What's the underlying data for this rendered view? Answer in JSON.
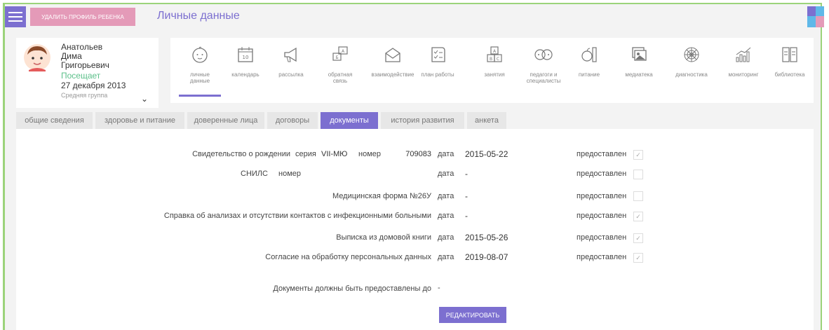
{
  "header": {
    "delete_label": "УДАЛИТЬ ПРОФИЛЬ РЕБЕНКА",
    "page_title": "Личные данные"
  },
  "profile": {
    "name_line1": "Анатольев",
    "name_line2": "Дима",
    "name_line3": "Григорьевич",
    "status": "Посещает",
    "birth_date": "27 декабря 2013",
    "group": "Средняя группа"
  },
  "nav": {
    "items": [
      {
        "label": "личные данные",
        "icon": "baby-face-icon"
      },
      {
        "label": "календарь",
        "icon": "calendar-icon"
      },
      {
        "label": "рассылка",
        "icon": "megaphone-icon"
      },
      {
        "label": "обратная связь",
        "icon": "feedback-icon"
      },
      {
        "label": "взаимодействие",
        "icon": "envelope-icon"
      },
      {
        "label": "план работы",
        "icon": "checklist-icon"
      },
      {
        "label": "занятия",
        "icon": "blocks-icon"
      },
      {
        "label": "педагоги и специалисты",
        "icon": "teachers-icon"
      },
      {
        "label": "питание",
        "icon": "food-icon"
      },
      {
        "label": "медиатека",
        "icon": "media-icon"
      },
      {
        "label": "диагностика",
        "icon": "web-icon"
      },
      {
        "label": "мониторинг",
        "icon": "bar-chart-icon"
      },
      {
        "label": "библиотека",
        "icon": "book-icon"
      }
    ]
  },
  "tabs": [
    {
      "label": "общие сведения"
    },
    {
      "label": "здоровье и питание"
    },
    {
      "label": "доверенные лица"
    },
    {
      "label": "договоры"
    },
    {
      "label": "документы"
    },
    {
      "label": "история развития"
    },
    {
      "label": "анкета"
    }
  ],
  "documents": {
    "birth_cert": {
      "label": "Свидетельство о рождении",
      "series_label": "серия",
      "series": "VII-МЮ",
      "number_label": "номер",
      "number": "709083",
      "date_label": "дата",
      "date": "2015-05-22",
      "provided": "предоставлен",
      "checked": true
    },
    "snils": {
      "label": "СНИЛС",
      "number_label": "номер",
      "date_label": "дата",
      "date": "-",
      "provided": "предоставлен",
      "checked": false
    },
    "med_form": {
      "label": "Медицинская форма №26У",
      "date_label": "дата",
      "date": "-",
      "provided": "предоставлен",
      "checked": false
    },
    "analysis": {
      "label": "Справка об анализах и отсутствии контактов с инфекционными больными",
      "date_label": "дата",
      "date": "-",
      "provided": "предоставлен",
      "checked": true
    },
    "house_book": {
      "label": "Выписка из домовой книги",
      "date_label": "дата",
      "date": "2015-05-26",
      "provided": "предоставлен",
      "checked": true
    },
    "consent": {
      "label": "Согласие на обработку персональных данных",
      "date_label": "дата",
      "date": "2019-08-07",
      "provided": "предоставлен",
      "checked": true
    },
    "deadline_label": "Документы должны быть предоставлены до",
    "deadline": "-",
    "edit_label": "РЕДАКТИРОВАТЬ",
    "checkmark": "✓"
  }
}
